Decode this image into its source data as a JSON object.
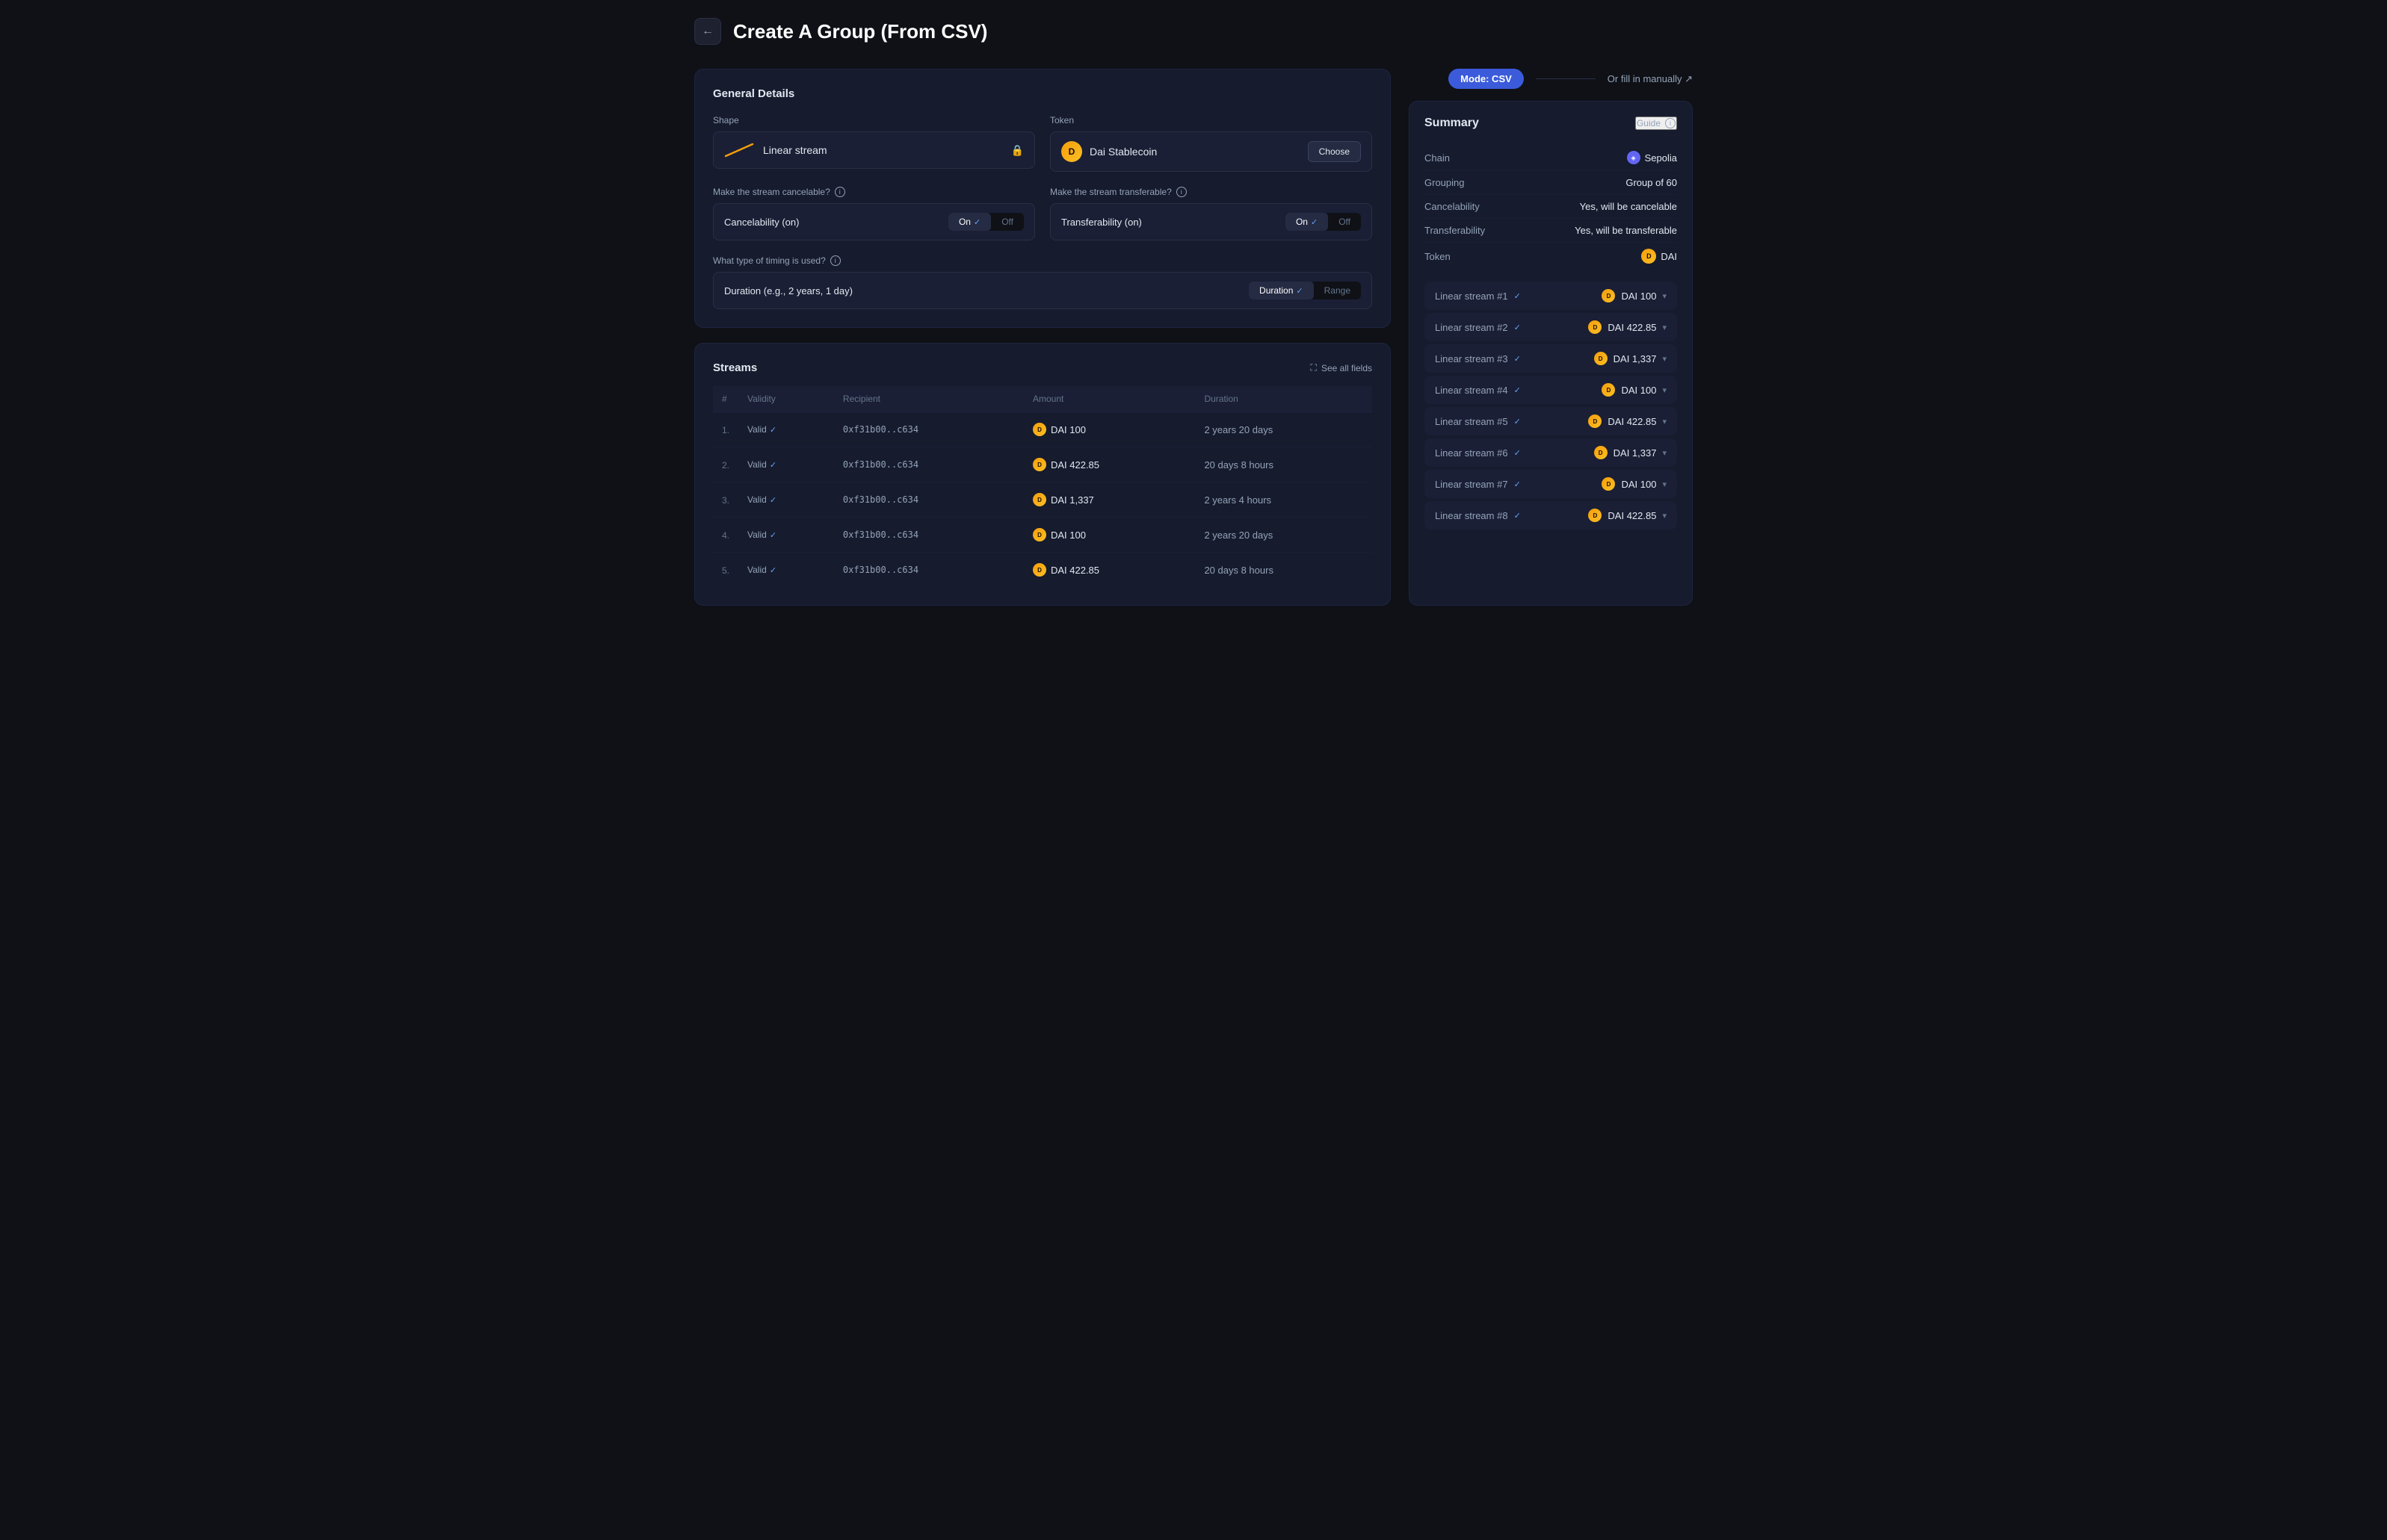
{
  "header": {
    "back_label": "←",
    "title": "Create A Group (From CSV)"
  },
  "mode": {
    "badge_label": "Mode: CSV",
    "manual_label": "Or fill in manually ↗"
  },
  "general_details": {
    "section_title": "General Details",
    "shape": {
      "label": "Shape",
      "value": "Linear stream",
      "lock_icon": "🔒"
    },
    "token": {
      "label": "Token",
      "name": "Dai Stablecoin",
      "choose_label": "Choose"
    },
    "cancelability": {
      "label": "Make the stream cancelable?",
      "field_label": "Cancelability (on)",
      "on_label": "On",
      "off_label": "Off",
      "active": "on"
    },
    "transferability": {
      "label": "Make the stream transferable?",
      "field_label": "Transferability (on)",
      "on_label": "On",
      "off_label": "Off",
      "active": "on"
    },
    "timing": {
      "label": "What type of timing is used?",
      "field_label": "Duration (e.g., 2 years, 1 day)",
      "duration_label": "Duration",
      "range_label": "Range",
      "active": "duration"
    }
  },
  "streams": {
    "section_title": "Streams",
    "see_all_label": "See all fields",
    "columns": {
      "num": "#",
      "validity": "Validity",
      "recipient": "Recipient",
      "amount": "Amount",
      "duration": "Duration"
    },
    "rows": [
      {
        "num": "1.",
        "validity": "Valid",
        "recipient": "0xf31b00..c634",
        "amount": "DAI 100",
        "duration": "2 years 20 days"
      },
      {
        "num": "2.",
        "validity": "Valid",
        "recipient": "0xf31b00..c634",
        "amount": "DAI 422.85",
        "duration": "20 days 8 hours"
      },
      {
        "num": "3.",
        "validity": "Valid",
        "recipient": "0xf31b00..c634",
        "amount": "DAI 1,337",
        "duration": "2 years 4 hours"
      },
      {
        "num": "4.",
        "validity": "Valid",
        "recipient": "0xf31b00..c634",
        "amount": "DAI 100",
        "duration": "2 years 20 days"
      },
      {
        "num": "5.",
        "validity": "Valid",
        "recipient": "0xf31b00..c634",
        "amount": "DAI 422.85",
        "duration": "20 days 8 hours"
      }
    ]
  },
  "summary": {
    "section_title": "Summary",
    "guide_label": "Guide",
    "rows": [
      {
        "key": "Chain",
        "value": "Sepolia",
        "icon": "chain"
      },
      {
        "key": "Grouping",
        "value": "Group of 60"
      },
      {
        "key": "Cancelability",
        "value": "Yes, will be cancelable"
      },
      {
        "key": "Transferability",
        "value": "Yes, will be transferable"
      },
      {
        "key": "Token",
        "value": "DAI",
        "icon": "dai"
      }
    ],
    "streams": [
      {
        "label": "Linear stream #1",
        "amount": "DAI 100"
      },
      {
        "label": "Linear stream #2",
        "amount": "DAI 422.85"
      },
      {
        "label": "Linear stream #3",
        "amount": "DAI 1,337"
      },
      {
        "label": "Linear stream #4",
        "amount": "DAI 100"
      },
      {
        "label": "Linear stream #5",
        "amount": "DAI 422.85"
      },
      {
        "label": "Linear stream #6",
        "amount": "DAI 1,337"
      },
      {
        "label": "Linear stream #7",
        "amount": "DAI 100"
      },
      {
        "label": "Linear stream #8",
        "amount": "DAI 422.85"
      }
    ]
  }
}
